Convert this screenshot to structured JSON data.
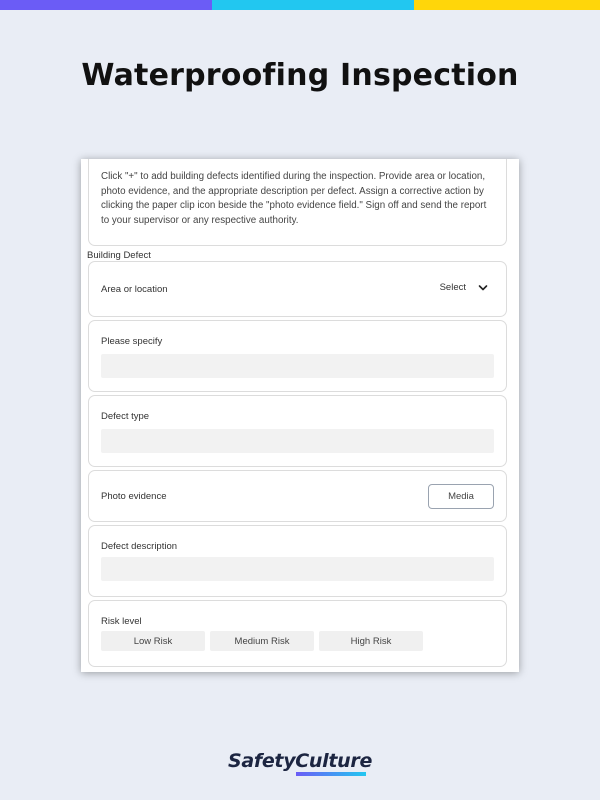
{
  "colors": {
    "bar_purple": "#6b5cf6",
    "bar_cyan": "#22c7f0",
    "bar_yellow": "#ffd60a",
    "background": "#e9edf5",
    "logo_underline": "#5b6cf0"
  },
  "page": {
    "title": "Waterproofing Inspection"
  },
  "form": {
    "intro": "Click \"+\" to add building defects identified during the inspection. Provide area or location, photo evidence, and the appropriate description per defect. Assign a corrective action by clicking the paper clip icon beside the \"photo evidence field.\" Sign off and send the report to your supervisor or any respective authority.",
    "section_title": "Building Defect",
    "area": {
      "label": "Area or location",
      "select_value": "Select",
      "icon": "chevron-down-icon"
    },
    "specify": {
      "label": "Please specify",
      "value": ""
    },
    "defect_type": {
      "label": "Defect type",
      "value": ""
    },
    "photo": {
      "label": "Photo evidence",
      "button_label": "Media"
    },
    "description": {
      "label": "Defect description",
      "value": ""
    },
    "risk": {
      "label": "Risk level",
      "options": [
        "Low Risk",
        "Medium Risk",
        "High Risk"
      ]
    }
  },
  "brand": {
    "logo_text": "SafetyCulture"
  }
}
